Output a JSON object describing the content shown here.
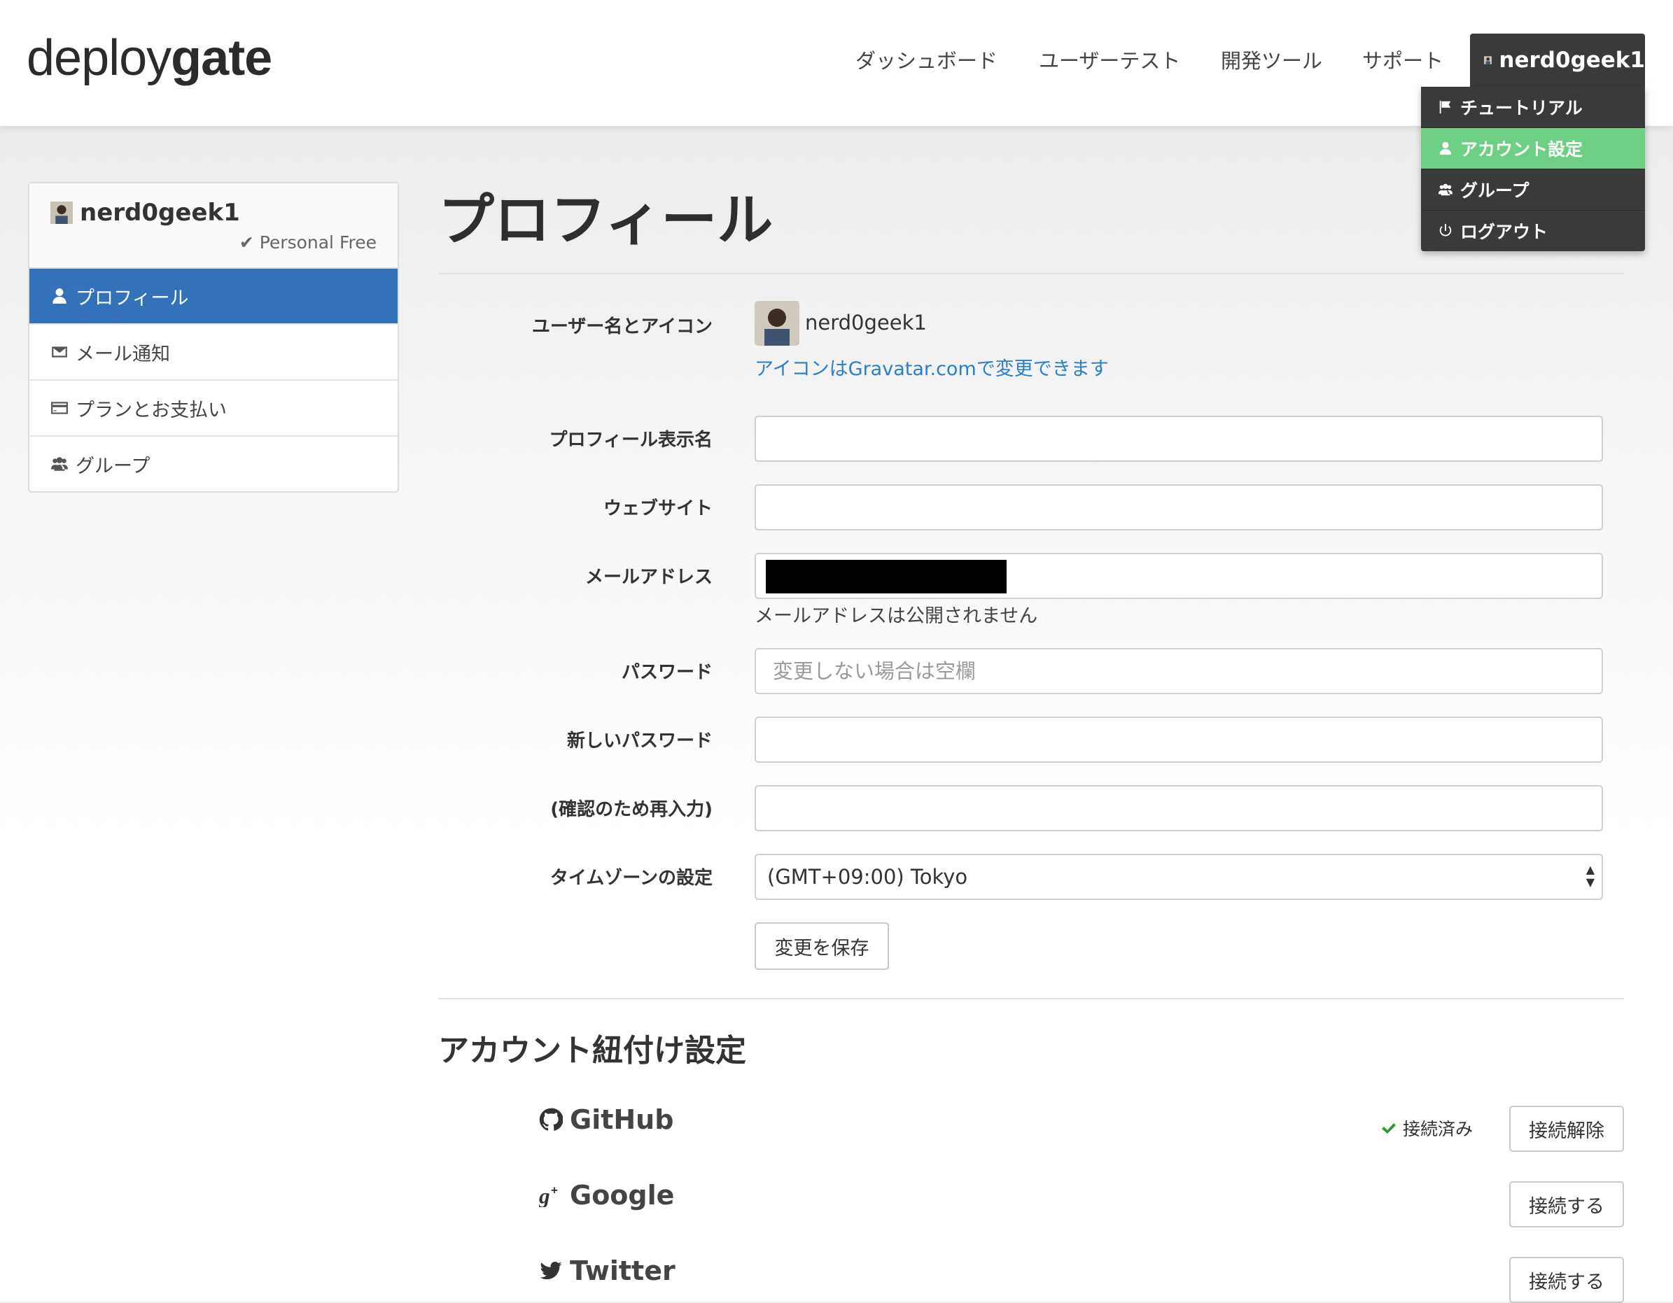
{
  "header": {
    "logo_light": "deploy",
    "logo_bold": "gate",
    "nav": [
      "ダッシュボード",
      "ユーザーテスト",
      "開発ツール",
      "サポート"
    ],
    "username": "nerd0geek1"
  },
  "dropdown": {
    "items": [
      {
        "label": "チュートリアル",
        "icon": "flag-icon"
      },
      {
        "label": "アカウント設定",
        "icon": "user-icon",
        "active": true
      },
      {
        "label": "グループ",
        "icon": "group-icon"
      },
      {
        "label": "ログアウト",
        "icon": "power-icon"
      }
    ]
  },
  "sidebar": {
    "username": "nerd0geek1",
    "plan": "✔ Personal Free",
    "items": [
      {
        "label": "プロフィール",
        "icon": "user-icon",
        "active": true
      },
      {
        "label": "メール通知",
        "icon": "envelope-icon"
      },
      {
        "label": "プランとお支払い",
        "icon": "credit-card-icon"
      },
      {
        "label": "グループ",
        "icon": "group-icon"
      }
    ]
  },
  "main": {
    "title": "プロフィール",
    "username_label": "ユーザー名とアイコン",
    "username_value": "nerd0geek1",
    "gravatar_link": "アイコンはGravatar.comで変更できます",
    "display_name_label": "プロフィール表示名",
    "display_name_value": "",
    "website_label": "ウェブサイト",
    "website_value": "",
    "email_label": "メールアドレス",
    "email_hint": "メールアドレスは公開されません",
    "password_label": "パスワード",
    "password_placeholder": "変更しない場合は空欄",
    "new_password_label": "新しいパスワード",
    "confirm_password_label": "(確認のため再入力)",
    "timezone_label": "タイムゾーンの設定",
    "timezone_value": "(GMT+09:00) Tokyo",
    "save_button": "変更を保存",
    "linking_title": "アカウント紐付け設定",
    "services": [
      {
        "name": "GitHub",
        "icon": "github-icon",
        "status": "接続済み",
        "button": "接続解除"
      },
      {
        "name": "Google",
        "icon": "google-plus-icon",
        "status": "",
        "button": "接続する"
      },
      {
        "name": "Twitter",
        "icon": "twitter-icon",
        "status": "",
        "button": "接続する"
      }
    ]
  },
  "colors": {
    "sidebar_active": "#3372b8",
    "dropdown_active": "#6ccf81",
    "dropdown_bg": "#3a3a3a",
    "link": "#2a7fc9",
    "connected_check": "#2a9d3a"
  }
}
